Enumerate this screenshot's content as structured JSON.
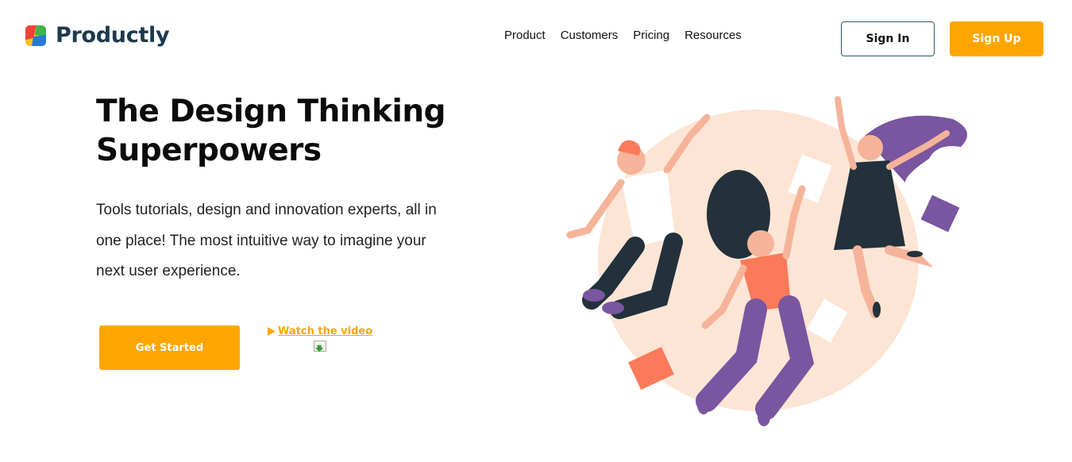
{
  "brand": {
    "name": "Productly",
    "logo_icon": "productly-logo-icon"
  },
  "nav": {
    "items": [
      {
        "label": "Product"
      },
      {
        "label": "Customers"
      },
      {
        "label": "Pricing"
      },
      {
        "label": "Resources"
      }
    ]
  },
  "auth": {
    "sign_in_label": "Sign In",
    "sign_up_label": "Sign Up"
  },
  "hero": {
    "title": "The Design Thinking Superpowers",
    "subtitle": "Tools tutorials, design and innovation experts, all in one place! The most intuitive way to imagine your next user experience.",
    "cta_label": "Get Started",
    "video_link_label": "Watch the video",
    "video_icon": "play-icon",
    "illustration": "jumping-people-illustration"
  },
  "colors": {
    "accent": "#ffa500",
    "brand_text": "#1d3a4c",
    "outline": "#2d5c70",
    "blob": "#fde5d5",
    "purple": "#7a55a0",
    "coral": "#fa7a5a",
    "dark": "#22313b"
  }
}
